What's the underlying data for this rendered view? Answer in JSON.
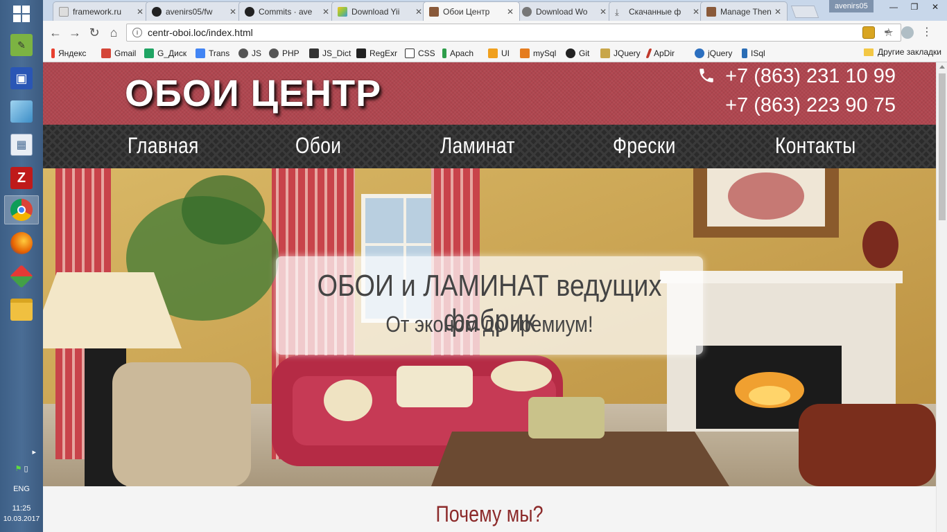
{
  "taskbar": {
    "apps": [
      {
        "name": "notepad-plus"
      },
      {
        "name": "save-disk"
      },
      {
        "name": "sublime"
      },
      {
        "name": "calculator"
      },
      {
        "name": "filezilla"
      },
      {
        "name": "chrome"
      },
      {
        "name": "firefox"
      },
      {
        "name": "app-diamond"
      },
      {
        "name": "file-explorer"
      }
    ],
    "language": "ENG",
    "time": "11:25",
    "date": "10.03.2017",
    "colors": {
      "bg": "#4a6d95"
    }
  },
  "browser": {
    "profile": "avenirs05",
    "tabs": [
      {
        "title": "framework.ru",
        "icon": "doc-icon"
      },
      {
        "title": "avenirs05/fw",
        "icon": "github-icon"
      },
      {
        "title": "Commits · ave",
        "icon": "github-icon"
      },
      {
        "title": "Download Yii",
        "icon": "yii-icon"
      },
      {
        "title": "Обои Центр",
        "icon": "site-icon",
        "active": true
      },
      {
        "title": "Download Wo",
        "icon": "wordpress-icon"
      },
      {
        "title": "Скачанные ф",
        "icon": "download-icon"
      },
      {
        "title": "Manage Then",
        "icon": "site-icon"
      }
    ],
    "url": "centr-oboi.loc/index.html",
    "bookmarks": [
      {
        "label": "Яндекс",
        "color": "#e8402f"
      },
      {
        "label": "Gmail",
        "color": "#d44638"
      },
      {
        "label": "G_Диск",
        "color": "#1fa463"
      },
      {
        "label": "Trans",
        "color": "#4285f4"
      },
      {
        "label": "JS",
        "color": "#555555"
      },
      {
        "label": "PHP",
        "color": "#555555"
      },
      {
        "label": "JS_Dict",
        "color": "#333333"
      },
      {
        "label": "RegExr",
        "color": "#222222"
      },
      {
        "label": "CSS",
        "color": "#333333"
      },
      {
        "label": "Apach",
        "color": "#2e9d4a"
      },
      {
        "label": "UI",
        "color": "#f0a01e"
      },
      {
        "label": "mySql",
        "color": "#e57c1f"
      },
      {
        "label": "Git",
        "color": "#222222"
      },
      {
        "label": "JQuery",
        "color": "#c8a64a"
      },
      {
        "label": "ApDir",
        "color": "#c0392b"
      },
      {
        "label": "jQuery",
        "color": "#2c6fbf"
      },
      {
        "label": "ISql",
        "color": "#2a6db5"
      }
    ],
    "other_bookmarks": "Другие закладки"
  },
  "site": {
    "logo": "ОБОИ ЦЕНТР",
    "phones": [
      "+7 (863) 231 10 99",
      "+7 (863) 223 90 75"
    ],
    "nav": [
      "Главная",
      "Обои",
      "Ламинат",
      "Фрески",
      "Контакты"
    ],
    "hero": {
      "title": "ОБОИ и ЛАМИНАТ ведущих фабрик",
      "subtitle": "От эконом до премиум!"
    },
    "why_title": "Почему мы?",
    "colors": {
      "header_bg": "#b0464f",
      "nav_bg": "#2b2b2b",
      "why_title": "#8c2a2a"
    }
  }
}
